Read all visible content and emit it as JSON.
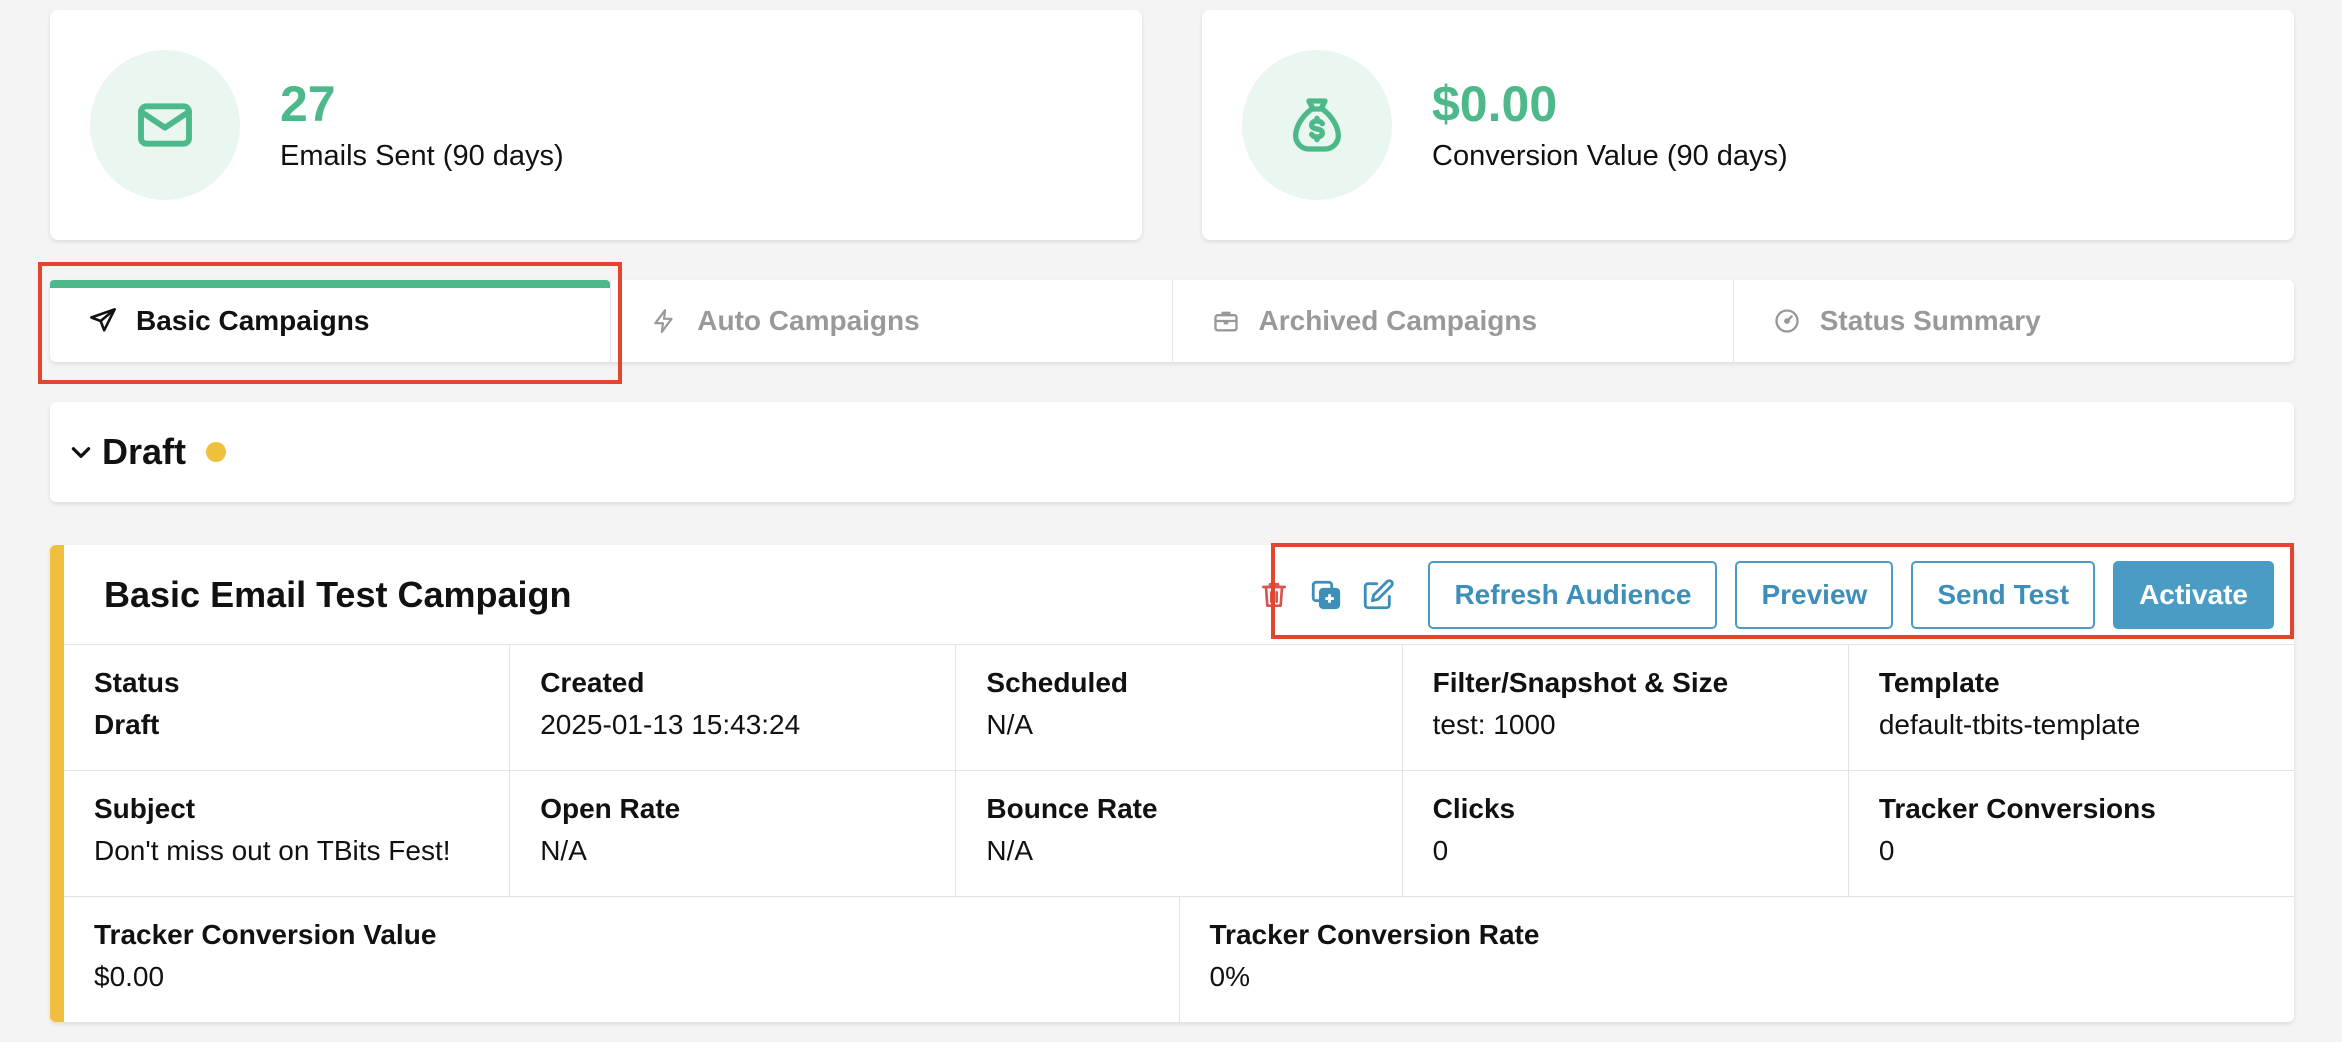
{
  "stats": {
    "emails": {
      "value": "27",
      "label": "Emails Sent (90 days)",
      "icon": "envelope-icon"
    },
    "conversion": {
      "value": "$0.00",
      "label": "Conversion Value (90 days)",
      "icon": "money-bag-icon"
    }
  },
  "tabs": [
    {
      "label": "Basic Campaigns",
      "icon": "send-icon",
      "active": true
    },
    {
      "label": "Auto Campaigns",
      "icon": "lightning-icon",
      "active": false
    },
    {
      "label": "Archived Campaigns",
      "icon": "briefcase-icon",
      "active": false
    },
    {
      "label": "Status Summary",
      "icon": "gauge-icon",
      "active": false
    }
  ],
  "draft": {
    "title": "Draft"
  },
  "campaign": {
    "title": "Basic Email Test Campaign",
    "actions": {
      "refresh": "Refresh Audience",
      "preview": "Preview",
      "send_test": "Send Test",
      "activate": "Activate"
    },
    "rows": [
      [
        {
          "label": "Status",
          "value": "Draft"
        },
        {
          "label": "Created",
          "value": "2025-01-13 15:43:24"
        },
        {
          "label": "Scheduled",
          "value": "N/A"
        },
        {
          "label": "Filter/Snapshot & Size",
          "value": "test: 1000"
        },
        {
          "label": "Template",
          "value": "default-tbits-template"
        }
      ],
      [
        {
          "label": "Subject",
          "value": "Don't miss out on TBits Fest!"
        },
        {
          "label": "Open Rate",
          "value": "N/A"
        },
        {
          "label": "Bounce Rate",
          "value": "N/A"
        },
        {
          "label": "Clicks",
          "value": "0"
        },
        {
          "label": "Tracker Conversions",
          "value": "0"
        }
      ],
      [
        {
          "label": "Tracker Conversion Value",
          "value": "$0.00"
        },
        {
          "label": "Tracker Conversion Rate",
          "value": "0%"
        }
      ]
    ]
  },
  "colors": {
    "accent_green": "#4db88a",
    "accent_blue": "#4a9cc4",
    "draft_yellow": "#f0bf3d",
    "danger_red": "#d9534f",
    "highlight_red": "#e2462f"
  }
}
